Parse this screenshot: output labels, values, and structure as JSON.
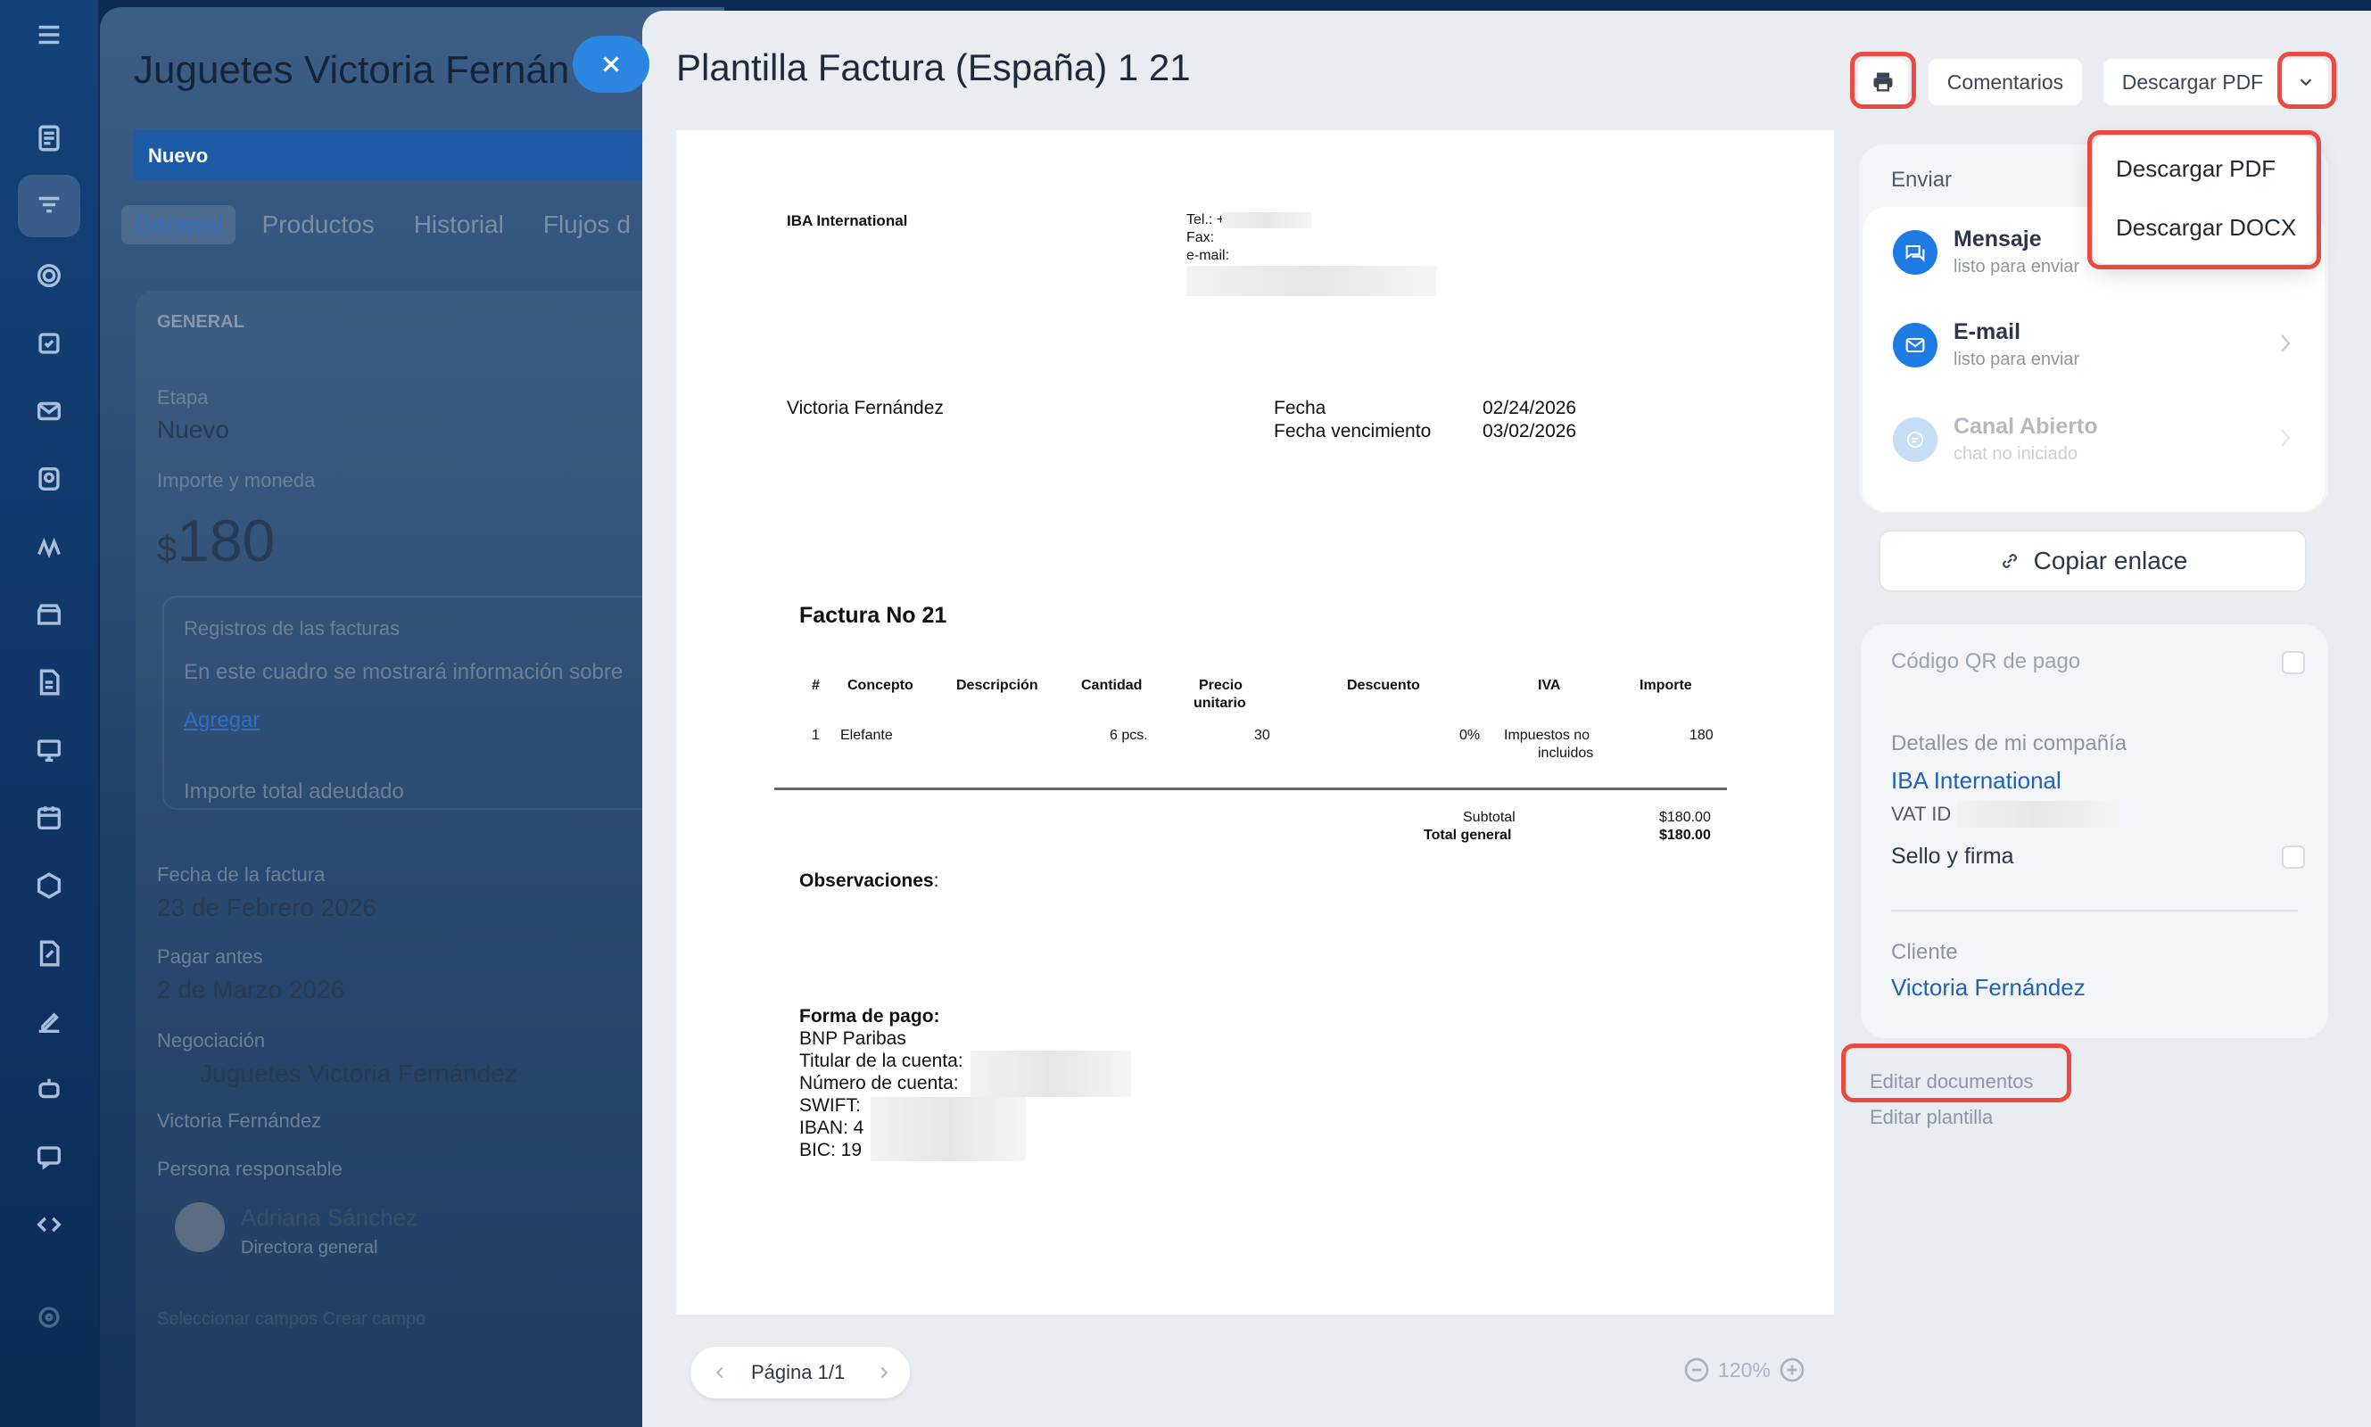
{
  "rail": {
    "icons": [
      "menu-icon",
      "document-icon",
      "funnel-icon",
      "target-icon",
      "task-icon",
      "mail-icon",
      "contacts-icon",
      "analytics-icon",
      "store-icon",
      "invoice-icon",
      "presentation-icon",
      "calendar-icon",
      "hexagon-icon",
      "edit-doc-icon",
      "sign-icon",
      "robot-icon",
      "chat-icon",
      "code-icon",
      "settings-icon"
    ]
  },
  "deal": {
    "title": "Juguetes Victoria Fernán",
    "stage": "Nuevo",
    "tabs": [
      "General",
      "Productos",
      "Historial",
      "Flujos d"
    ],
    "section_label": "GENERAL",
    "stage_label": "Etapa",
    "stage_value": "Nuevo",
    "amount_label": "Importe y moneda",
    "amount_currency": "$",
    "amount_value": "180",
    "invoices_label": "Registros de las facturas",
    "invoices_hint": "En este cuadro se mostrará información sobre",
    "add_link": "Agregar",
    "total_due": "Importe total adeudado",
    "invoice_date_label": "Fecha de la factura",
    "invoice_date_value": "23 de Febrero 2026",
    "pay_before_label": "Pagar antes",
    "pay_before_value": "2 de Marzo 2026",
    "deal_label": "Negociación",
    "deal_value": "Juguetes Victoria Fernández",
    "client_value": "Victoria Fernández",
    "responsible_label": "Persona responsable",
    "responsible_name": "Adriana Sánchez",
    "responsible_role": "Directora general",
    "footer_links": "Seleccionar campos   Crear campo"
  },
  "doc": {
    "title": "Plantilla Factura (España) 1 21",
    "comments_button": "Comentarios",
    "download_button": "Descargar PDF",
    "dropdown": [
      "Descargar PDF",
      "Descargar DOCX"
    ]
  },
  "invoice": {
    "company": "IBA International",
    "tel": "Tel.: +34",
    "fax": "Fax:",
    "email": "e-mail:",
    "client": "Victoria Fernández",
    "date_label": "Fecha",
    "date_value": "02/24/2026",
    "due_label": "Fecha vencimiento",
    "due_value": "03/02/2026",
    "number": "Factura No 21",
    "columns": [
      "#",
      "Concepto",
      "Descripción",
      "Cantidad",
      "Precio",
      "unitario",
      "Descuento",
      "IVA",
      "Importe"
    ],
    "row": {
      "n": "1",
      "concept": "Elefante",
      "qty": "6 pcs.",
      "price": "30",
      "discount": "0%",
      "vat1": "Impuestos no",
      "vat2": "incluidos",
      "amount": "180"
    },
    "subtotal_label": "Subtotal",
    "subtotal_value": "$180.00",
    "total_label": "Total general",
    "total_value": "$180.00",
    "observations": "Observaciones",
    "payment_title": "Forma de pago:",
    "bank": "BNP Paribas",
    "holder": "Titular de la cuenta:",
    "account": "Número de cuenta:",
    "swift": "SWIFT:",
    "iban": "IBAN: 4",
    "bic": "BIC: 19"
  },
  "pager": {
    "label": "Página 1/1",
    "zoom": "120%"
  },
  "side": {
    "send_title": "Enviar",
    "channels": [
      {
        "name": "Mensaje",
        "status": "listo para enviar"
      },
      {
        "name": "E-mail",
        "status": "listo para enviar"
      },
      {
        "name": "Canal Abierto",
        "status": "chat no iniciado"
      }
    ],
    "copy_link": "Copiar enlace",
    "qr_label": "Código QR de pago",
    "company_label": "Detalles de mi compañía",
    "company_value": "IBA International",
    "vat_label": "VAT ID",
    "stamp_label": "Sello y firma",
    "client_label": "Cliente",
    "client_value": "Victoria Fernández",
    "edit_docs": "Editar documentos",
    "edit_template": "Editar plantilla"
  },
  "colors": {
    "accent": "#2e6fc4",
    "highlight": "#ec4a40",
    "link": "#1f63b4"
  }
}
